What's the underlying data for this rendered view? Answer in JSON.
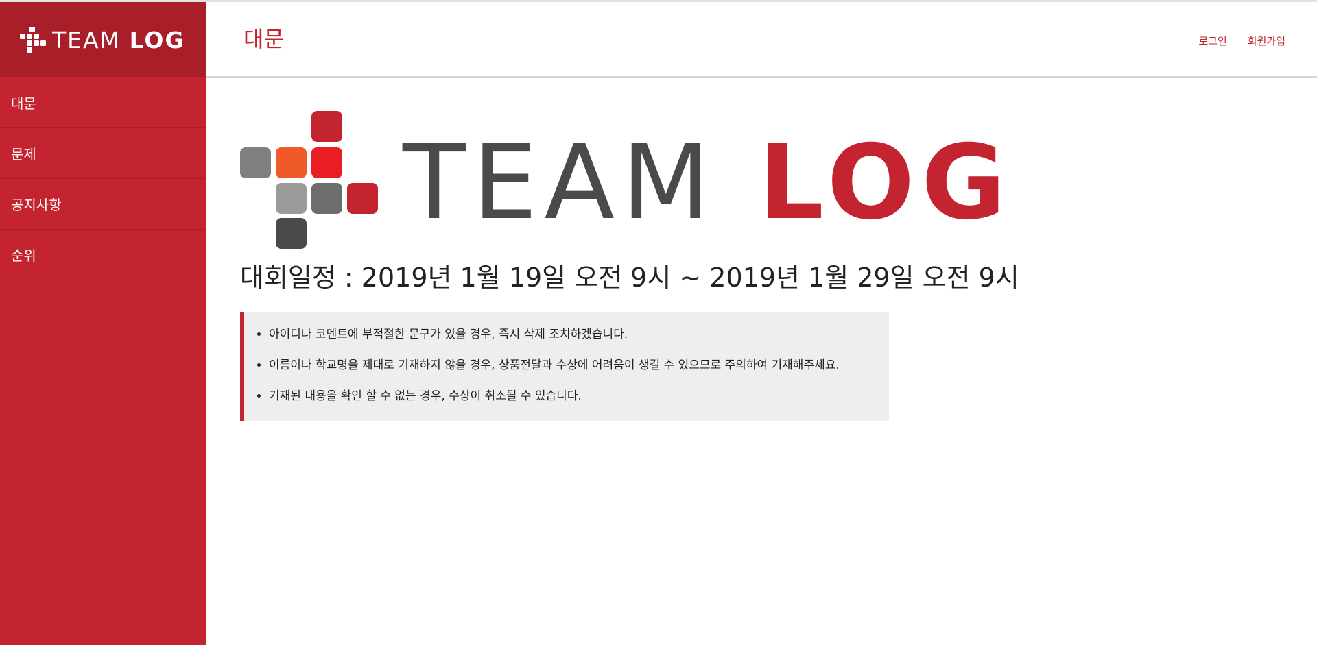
{
  "brand": {
    "name_part1": "TEAM",
    "name_part2": "LOG"
  },
  "sidebar": {
    "items": [
      {
        "label": "대문"
      },
      {
        "label": "문제"
      },
      {
        "label": "공지사항"
      },
      {
        "label": "순위"
      }
    ]
  },
  "header": {
    "title": "대문",
    "links": {
      "login": "로그인",
      "signup": "회원가입"
    }
  },
  "main": {
    "logo": {
      "word1": "TEAM",
      "word2": "LOG"
    },
    "schedule": "대회일정 : 2019년 1월 19일 오전 9시 ~ 2019년 1월 29일 오전 9시",
    "notices": [
      "아이디나 코멘트에 부적절한 문구가 있을 경우, 즉시 삭제 조치하겠습니다.",
      "이름이나 학교명을 제대로 기재하지 않을 경우, 상품전달과 수상에 어려움이 생길 수 있으므로 주의하여 기재해주세요.",
      "기재된 내용을 확인 할 수 없는 경우, 수상이 취소될 수 있습니다."
    ]
  },
  "colors": {
    "accent": "#c4242f",
    "sidebar_dark": "#a81e29",
    "logo_gray_light": "#808080",
    "logo_orange": "#f05a28",
    "logo_red_bright": "#ec1c24",
    "logo_gray_mid": "#9b9b9b",
    "logo_gray_dark": "#6d6d6d",
    "logo_charcoal": "#4a4a4a"
  }
}
